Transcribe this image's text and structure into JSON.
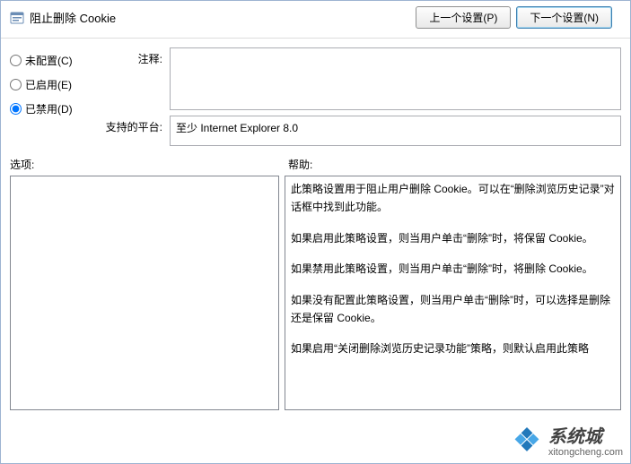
{
  "header": {
    "title": "阻止删除 Cookie",
    "prev_button": "上一个设置(P)",
    "next_button": "下一个设置(N)"
  },
  "radios": {
    "not_configured": "未配置(C)",
    "enabled": "已启用(E)",
    "disabled": "已禁用(D)"
  },
  "fields": {
    "comment_label": "注释:",
    "comment_value": "",
    "platform_label": "支持的平台:",
    "platform_value": "至少 Internet Explorer 8.0"
  },
  "sections": {
    "options_label": "选项:",
    "help_label": "帮助:"
  },
  "help_paragraphs": [
    "此策略设置用于阻止用户删除 Cookie。可以在“删除浏览历史记录”对话框中找到此功能。",
    "如果启用此策略设置，则当用户单击“删除”时，将保留 Cookie。",
    "如果禁用此策略设置，则当用户单击“删除”时，将删除 Cookie。",
    "如果没有配置此策略设置，则当用户单击“删除”时，可以选择是删除还是保留 Cookie。",
    "如果启用“关闭删除浏览历史记录功能”策略，则默认启用此策略"
  ],
  "watermark": {
    "main": "系统城",
    "url": "xitongcheng.com"
  }
}
